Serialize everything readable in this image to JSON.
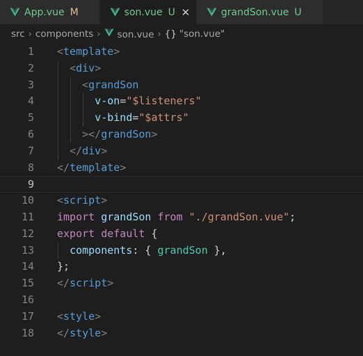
{
  "tabs": [
    {
      "name": "App.vue",
      "status": "M",
      "status_kind": "modified",
      "icon": "vue-icon",
      "active": false,
      "closable": false
    },
    {
      "name": "son.vue",
      "status": "U",
      "status_kind": "untracked",
      "icon": "vue-icon",
      "active": true,
      "closable": true
    },
    {
      "name": "grandSon.vue",
      "status": "U",
      "status_kind": "untracked",
      "icon": "vue-icon",
      "active": false,
      "closable": false
    }
  ],
  "close_glyph": "✕",
  "breadcrumb": {
    "items": [
      "src",
      "components",
      "son.vue"
    ],
    "separator": "›",
    "symbol_icon": "{}",
    "symbol": "\"son.vue\""
  },
  "editor": {
    "current_line": 9,
    "lines": [
      {
        "number": "1",
        "indent": 0,
        "tokens": [
          {
            "t": "<",
            "c": "punc"
          },
          {
            "t": "template",
            "c": "tag"
          },
          {
            "t": ">",
            "c": "punc"
          }
        ]
      },
      {
        "number": "2",
        "indent": 1,
        "tokens": [
          {
            "t": "<",
            "c": "punc"
          },
          {
            "t": "div",
            "c": "tag"
          },
          {
            "t": ">",
            "c": "punc"
          }
        ]
      },
      {
        "number": "3",
        "indent": 2,
        "tokens": [
          {
            "t": "<",
            "c": "punc"
          },
          {
            "t": "grandSon",
            "c": "tag"
          }
        ]
      },
      {
        "number": "4",
        "indent": 3,
        "tokens": [
          {
            "t": "v-on",
            "c": "attr"
          },
          {
            "t": "=",
            "c": "plain"
          },
          {
            "t": "\"$listeners\"",
            "c": "str"
          }
        ]
      },
      {
        "number": "5",
        "indent": 3,
        "tokens": [
          {
            "t": "v-bind",
            "c": "attr"
          },
          {
            "t": "=",
            "c": "plain"
          },
          {
            "t": "\"$attrs\"",
            "c": "str"
          }
        ]
      },
      {
        "number": "6",
        "indent": 2,
        "tokens": [
          {
            "t": "></",
            "c": "punc"
          },
          {
            "t": "grandSon",
            "c": "tag"
          },
          {
            "t": ">",
            "c": "punc"
          }
        ]
      },
      {
        "number": "7",
        "indent": 1,
        "tokens": [
          {
            "t": "</",
            "c": "punc"
          },
          {
            "t": "div",
            "c": "tag"
          },
          {
            "t": ">",
            "c": "punc"
          }
        ]
      },
      {
        "number": "8",
        "indent": 0,
        "tokens": [
          {
            "t": "</",
            "c": "punc"
          },
          {
            "t": "template",
            "c": "tag"
          },
          {
            "t": ">",
            "c": "punc"
          }
        ]
      },
      {
        "number": "9",
        "indent": 0,
        "tokens": []
      },
      {
        "number": "10",
        "indent": 0,
        "tokens": [
          {
            "t": "<",
            "c": "punc"
          },
          {
            "t": "script",
            "c": "tag"
          },
          {
            "t": ">",
            "c": "punc"
          }
        ]
      },
      {
        "number": "11",
        "indent": 0,
        "tokens": [
          {
            "t": "import",
            "c": "kw"
          },
          {
            "t": " ",
            "c": "plain"
          },
          {
            "t": "grandSon",
            "c": "attr"
          },
          {
            "t": " ",
            "c": "plain"
          },
          {
            "t": "from",
            "c": "kw"
          },
          {
            "t": " ",
            "c": "plain"
          },
          {
            "t": "\"./grandSon.vue\"",
            "c": "str"
          },
          {
            "t": ";",
            "c": "plain"
          }
        ]
      },
      {
        "number": "12",
        "indent": 0,
        "tokens": [
          {
            "t": "export",
            "c": "kw"
          },
          {
            "t": " ",
            "c": "plain"
          },
          {
            "t": "default",
            "c": "kw"
          },
          {
            "t": " {",
            "c": "plain"
          }
        ]
      },
      {
        "number": "13",
        "indent": 1,
        "tokens": [
          {
            "t": "components",
            "c": "attr"
          },
          {
            "t": ": { ",
            "c": "plain"
          },
          {
            "t": "grandSon",
            "c": "comp"
          },
          {
            "t": " },",
            "c": "plain"
          }
        ]
      },
      {
        "number": "14",
        "indent": 0,
        "tokens": [
          {
            "t": "};",
            "c": "plain"
          }
        ]
      },
      {
        "number": "15",
        "indent": 0,
        "tokens": [
          {
            "t": "</",
            "c": "punc"
          },
          {
            "t": "script",
            "c": "tag"
          },
          {
            "t": ">",
            "c": "punc"
          }
        ]
      },
      {
        "number": "16",
        "indent": 0,
        "tokens": []
      },
      {
        "number": "17",
        "indent": 0,
        "tokens": [
          {
            "t": "<",
            "c": "punc"
          },
          {
            "t": "style",
            "c": "tag"
          },
          {
            "t": ">",
            "c": "punc"
          }
        ]
      },
      {
        "number": "18",
        "indent": 0,
        "tokens": [
          {
            "t": "</",
            "c": "punc"
          },
          {
            "t": "style",
            "c": "tag"
          },
          {
            "t": ">",
            "c": "punc"
          }
        ]
      }
    ]
  },
  "colors": {
    "vue_green": "#41b883",
    "vue_dark": "#35495e",
    "untracked": "#73c991",
    "modified": "#e2c08d"
  }
}
